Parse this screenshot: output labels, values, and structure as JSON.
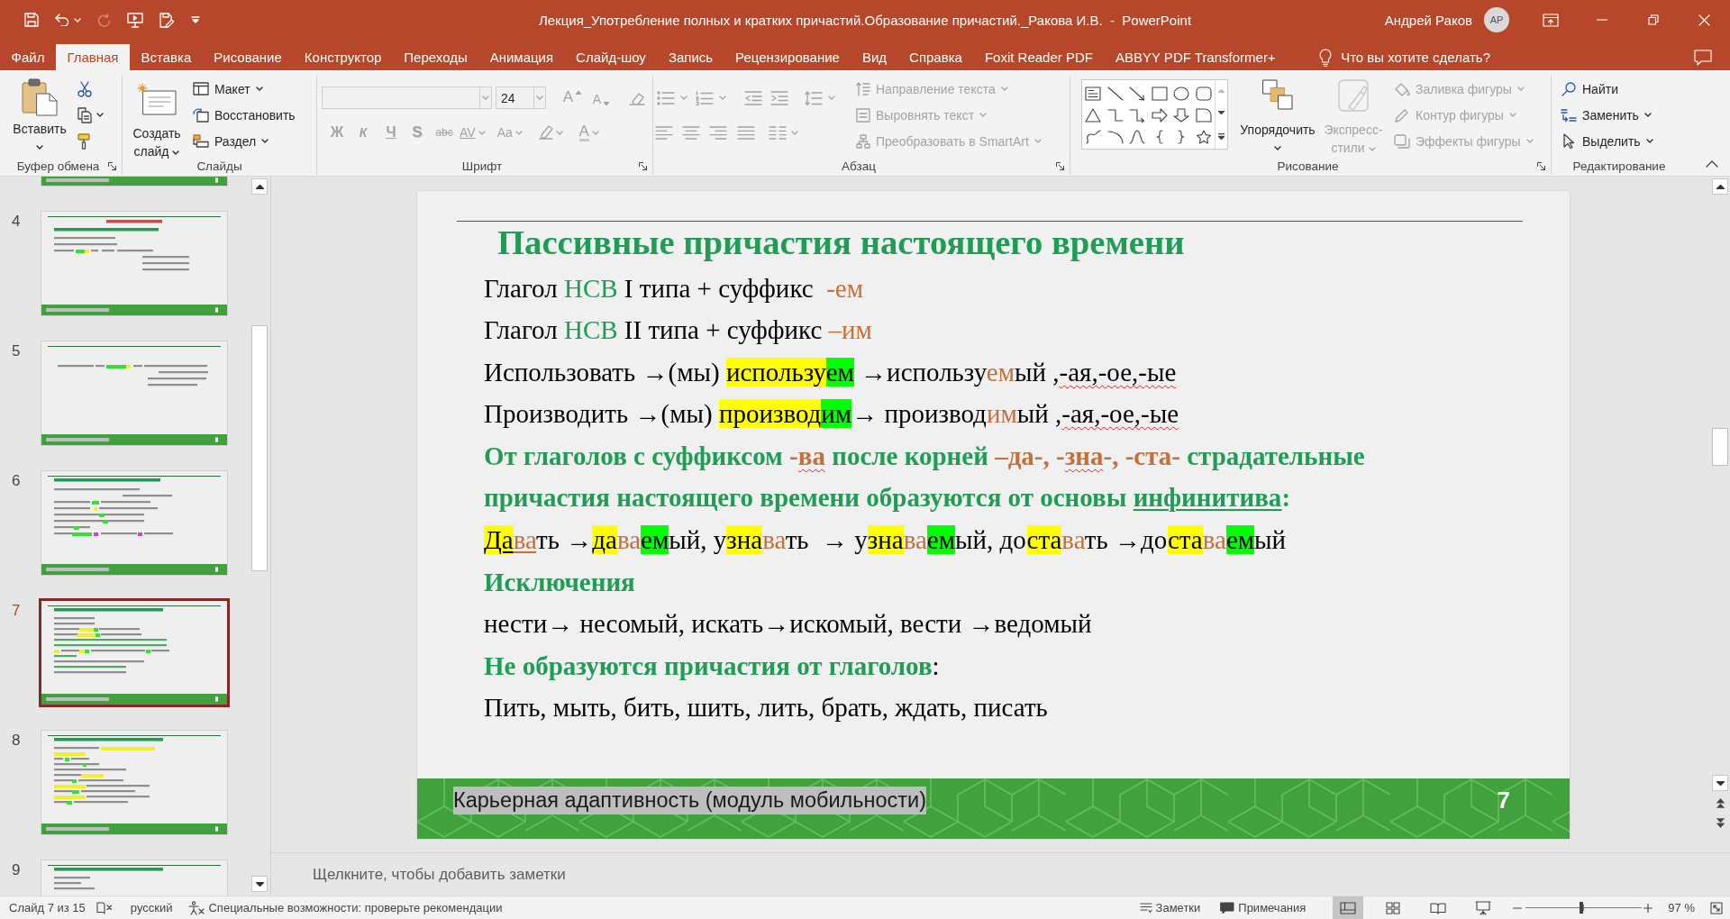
{
  "title_bar": {
    "quick_access": [
      {
        "kind": "save"
      },
      {
        "kind": "undo",
        "dropdown": true
      },
      {
        "kind": "redo",
        "disabled": true
      },
      {
        "kind": "present"
      },
      {
        "kind": "save_as"
      },
      {
        "kind": "customize"
      }
    ],
    "document_title": "Лекция_Употребление полных и кратких причастий.Образование причастий._Ракова И.В.  -  PowerPoint",
    "user_name": "Андрей Раков",
    "avatar_initials": "АР"
  },
  "ribbon_tabs": [
    {
      "label": "Файл",
      "selected": false
    },
    {
      "label": "Главная",
      "selected": true
    },
    {
      "label": "Вставка",
      "selected": false
    },
    {
      "label": "Рисование",
      "selected": false
    },
    {
      "label": "Конструктор",
      "selected": false
    },
    {
      "label": "Переходы",
      "selected": false
    },
    {
      "label": "Анимация",
      "selected": false
    },
    {
      "label": "Слайд-шоу",
      "selected": false
    },
    {
      "label": "Запись",
      "selected": false
    },
    {
      "label": "Рецензирование",
      "selected": false
    },
    {
      "label": "Вид",
      "selected": false
    },
    {
      "label": "Справка",
      "selected": false
    },
    {
      "label": "Foxit Reader PDF",
      "selected": false
    },
    {
      "label": "ABBYY PDF Transformer+",
      "selected": false
    }
  ],
  "tell_me": {
    "placeholder": "Что вы хотите сделать?"
  },
  "ribbon": {
    "clipboard": {
      "label": "Буфер обмена",
      "paste": {
        "label": "Вставить"
      }
    },
    "slides": {
      "label": "Слайды",
      "new_slide": {
        "label": "Создать слайд"
      },
      "commands": [
        {
          "kind": "layout",
          "label": "Макет",
          "dropdown": true
        },
        {
          "kind": "reset",
          "label": "Восстановить"
        },
        {
          "kind": "section",
          "label": "Раздел",
          "dropdown": true
        }
      ]
    },
    "font": {
      "label": "Шрифт",
      "disabled": true,
      "font_size": "24",
      "size_buttons": [
        {
          "kind": "grow",
          "label": "A"
        },
        {
          "kind": "shrink",
          "label": "A"
        }
      ],
      "format_buttons": [
        {
          "kind": "bold",
          "label": "Ж"
        },
        {
          "kind": "italic",
          "label": "К"
        },
        {
          "kind": "underline",
          "label": "Ч"
        },
        {
          "kind": "shadow",
          "label": "S"
        },
        {
          "kind": "strike",
          "label": "abc"
        },
        {
          "kind": "spacing",
          "label": "AV",
          "dropdown": true
        },
        {
          "kind": "case",
          "label": "Aa",
          "dropdown": true
        },
        {
          "kind": "highlight",
          "dropdown": true
        },
        {
          "kind": "color",
          "label": "A",
          "dropdown": true
        }
      ]
    },
    "paragraph": {
      "label": "Абзац",
      "disabled": true,
      "commands": [
        {
          "kind": "direction",
          "label": "Направление текста"
        },
        {
          "kind": "align",
          "label": "Выровнять текст"
        },
        {
          "kind": "smartart",
          "label": "Преобразовать в SmartArt"
        }
      ]
    },
    "drawing": {
      "label": "Рисование",
      "arrange": {
        "label": "Упорядочить"
      },
      "quick_styles": {
        "label": "Экспресс-стили",
        "disabled": true
      },
      "commands": [
        {
          "kind": "fill",
          "label": "Заливка фигуры",
          "disabled": true
        },
        {
          "kind": "outline",
          "label": "Контур фигуры",
          "disabled": true
        },
        {
          "kind": "effects",
          "label": "Эффекты фигуры",
          "disabled": true
        }
      ]
    },
    "editing": {
      "label": "Редактирование",
      "commands": [
        {
          "kind": "find",
          "label": "Найти"
        },
        {
          "kind": "replace",
          "label": "Заменить",
          "dropdown": true
        },
        {
          "kind": "select",
          "label": "Выделить",
          "dropdown": true
        }
      ]
    }
  },
  "thumbnails": [
    {
      "selected": false
    },
    {
      "number": "4",
      "selected": false
    },
    {
      "number": "5",
      "selected": false
    },
    {
      "number": "6",
      "selected": false
    },
    {
      "number": "7",
      "selected": true
    },
    {
      "number": "8",
      "selected": false
    },
    {
      "number": "9",
      "selected": false
    }
  ],
  "slide": {
    "title": "Пассивные причастия настоящего времени",
    "lines": [
      {
        "kind": "body",
        "runs": [
          {
            "text": "Глагол "
          },
          {
            "text": "НСВ",
            "color": "#1f9d55"
          },
          {
            "text": " I типа + суффикс  "
          },
          {
            "text": "-ем",
            "color": "#c5703b"
          }
        ]
      },
      {
        "kind": "body",
        "runs": [
          {
            "text": "Глагол "
          },
          {
            "text": "НСВ",
            "color": "#1f9d55"
          },
          {
            "text": " II типа + суффикс "
          },
          {
            "text": "–им",
            "color": "#c5703b"
          }
        ]
      },
      {
        "kind": "body",
        "runs": [
          {
            "text": "Использовать →(мы) "
          },
          {
            "text": "использу",
            "kind": "stem"
          },
          {
            "text": "ем",
            "kind": "ending"
          },
          {
            "text": " →использу"
          },
          {
            "text": "ем",
            "color": "#c5703b"
          },
          {
            "text": "ый ,"
          },
          {
            "text": "-ая,-ое,-ые",
            "spellcheck": true
          }
        ]
      },
      {
        "kind": "body",
        "runs": [
          {
            "text": "Производить →(мы) "
          },
          {
            "text": "производ",
            "kind": "stem"
          },
          {
            "text": "им",
            "kind": "ending"
          },
          {
            "text": "→ производ"
          },
          {
            "text": "им",
            "color": "#c5703b"
          },
          {
            "text": "ый ,"
          },
          {
            "text": "-ая,-ое,-ые",
            "spellcheck": true
          }
        ]
      },
      {
        "kind": "heading",
        "runs": [
          {
            "text": "От глаголов с суффиксом "
          },
          {
            "text": "-",
            "color": "#c5703b"
          },
          {
            "text": "ва",
            "color": "#c5703b",
            "spellcheck": true
          },
          {
            "text": " после корней "
          },
          {
            "text": "–да-, -",
            "color": "#c5703b"
          },
          {
            "text": "зна",
            "color": "#c5703b",
            "spellcheck": true
          },
          {
            "text": "-, -ста-",
            "color": "#c5703b"
          },
          {
            "text": " страдательные причастия настоящего времени образуются от основы "
          },
          {
            "text": "инфинитива",
            "underline": true
          },
          {
            "text": ":"
          }
        ]
      },
      {
        "kind": "body",
        "runs": [
          {
            "text": "Да",
            "kind": "stem",
            "underline": true
          },
          {
            "text": "ва",
            "color": "#c5703b",
            "underline": true
          },
          {
            "text": "ть →"
          },
          {
            "text": "да",
            "kind": "stem"
          },
          {
            "text": "ва",
            "color": "#c5703b"
          },
          {
            "text": "ем",
            "kind": "ending"
          },
          {
            "text": "ый, у"
          },
          {
            "text": "зна",
            "kind": "stem"
          },
          {
            "text": "ва",
            "color": "#c5703b"
          },
          {
            "text": "ть  → у"
          },
          {
            "text": "зна",
            "kind": "stem"
          },
          {
            "text": "ва",
            "color": "#c5703b"
          },
          {
            "text": "ем",
            "kind": "ending"
          },
          {
            "text": "ый, до"
          },
          {
            "text": "ста",
            "kind": "stem"
          },
          {
            "text": "ва",
            "color": "#c5703b"
          },
          {
            "text": "ть →до"
          },
          {
            "text": "ста",
            "kind": "stem"
          },
          {
            "text": "ва",
            "color": "#c5703b"
          },
          {
            "text": "ем",
            "kind": "ending"
          },
          {
            "text": "ый"
          }
        ]
      },
      {
        "kind": "heading",
        "runs": [
          {
            "text": "Исключения"
          }
        ]
      },
      {
        "kind": "body",
        "runs": [
          {
            "text": "нести→ несомый, искать→искомый, вести →ведомый"
          }
        ]
      },
      {
        "kind": "heading",
        "runs": [
          {
            "text": "Не образуются причастия от глаголов"
          },
          {
            "text": ":",
            "plain": true
          }
        ]
      },
      {
        "kind": "body",
        "runs": [
          {
            "text": "Пить, мыть, бить, шить, лить, брать, ждать, писать"
          }
        ]
      }
    ],
    "footer": {
      "text": "Карьерная адаптивность (модуль мобильности)",
      "number": "7"
    }
  },
  "notes": {
    "placeholder": "Щелкните, чтобы добавить заметки"
  },
  "status_bar": {
    "slide_indicator": "Слайд 7 из 15",
    "language": "русский",
    "accessibility": "Специальные возможности: проверьте рекомендации",
    "notes_button": "Заметки",
    "comments_button": "Примечания",
    "views": [
      {
        "kind": "normal",
        "selected": true
      },
      {
        "kind": "sorter",
        "selected": false
      },
      {
        "kind": "reading",
        "selected": false
      },
      {
        "kind": "slideshow",
        "selected": false
      }
    ],
    "zoom": {
      "level": 0.48,
      "reading": "97 %"
    }
  }
}
